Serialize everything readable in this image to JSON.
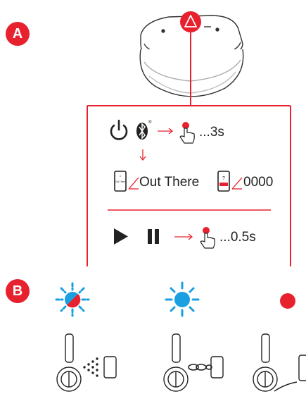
{
  "accent_color": "#e8212e",
  "blue_color": "#1a9fe0",
  "section_a": {
    "badge": "A"
  },
  "section_b": {
    "badge": "B"
  },
  "pairing": {
    "hold_time": "...3s",
    "lcd_name_label": "Out There",
    "lcd_pin_label": "0000",
    "lcd_small_text": "Out There",
    "lcd_question": "?"
  },
  "playback": {
    "hold_time": "...0.5s"
  },
  "status_lights": [
    {
      "state": "pairing",
      "light": "blue-red-flashing"
    },
    {
      "state": "connected",
      "light": "blue"
    },
    {
      "state": "charging",
      "light": "red"
    }
  ]
}
